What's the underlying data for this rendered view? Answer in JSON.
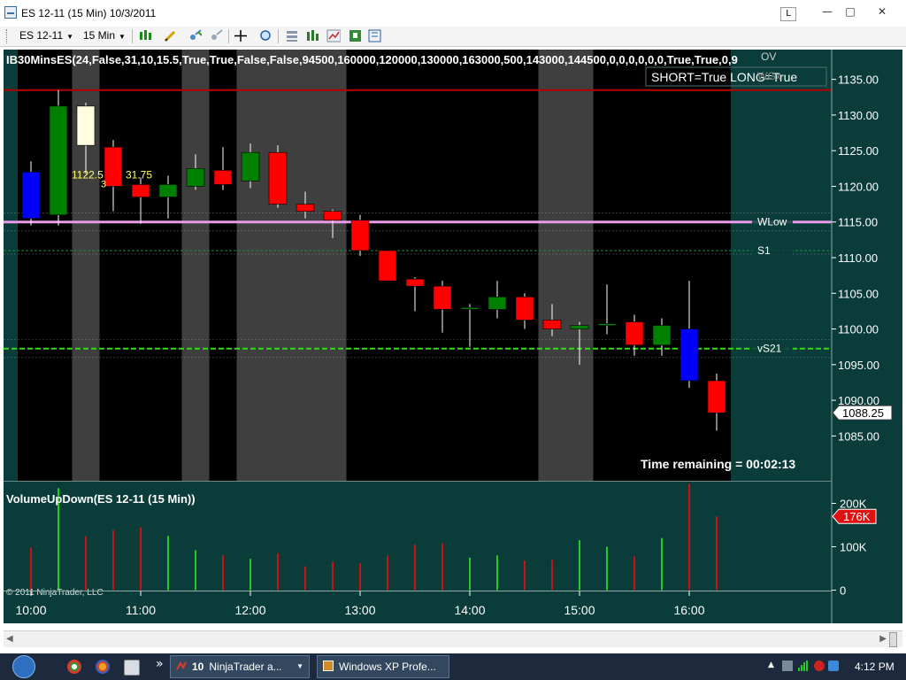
{
  "window": {
    "title": "ES 12-11 (15 Min)  10/3/2011",
    "l_button": "L",
    "min_glyph": "—",
    "max_glyph": "□",
    "close_glyph": "✕"
  },
  "toolbar": {
    "instrument": "ES 12-11",
    "interval": "15 Min",
    "dropdown_glyph": "▼",
    "icons": [
      "candlestick-style-icon",
      "pencil-draw-icon",
      "add-indicator-icon",
      "remove-indicator-icon",
      "crosshair-icon",
      "zoom-icon",
      "properties-icon",
      "bar-chart-icon",
      "line-chart-icon",
      "strategy-icon",
      "data-box-icon"
    ]
  },
  "colors": {
    "panel_bg": "#0a3d3a",
    "plot_bg": "#000000",
    "session_band": "#3f3f3f",
    "up_candle": "#008000",
    "down_candle": "#ff0000",
    "blue_candle": "#0000ff",
    "doji_candle": "#fffde0",
    "wick": "#ffffff",
    "axis_text": "#ffffff",
    "wlow_line": "#e79ae7",
    "top_red_line": "#b30000",
    "green_dash": "#33dd11",
    "vol_up": "#22cc22",
    "vol_down": "#cc1111",
    "label_yellow": "#ffff66"
  },
  "price_panel": {
    "indicator_text": "IB30MinsES(24,False,31,10,15.5,True,True,False,False,94500,160000,120000,130000,163000,500,143000,144500,0,0,0,0,0,0,True,True,0,9",
    "short_long_text": "SHORT=True LONG=True",
    "ov_label": "OV",
    "wh_label": "WGx",
    "wlow_label": "WLow",
    "s1_label": "S1",
    "s2_label": "vS21",
    "hl_label_1": "1122.5",
    "hl_label_2": "31.75",
    "hl_label_3": "3",
    "time_remaining": "Time remaining = 00:02:13",
    "last_price_label": "1088.25"
  },
  "volume_panel": {
    "title": "VolumeUpDown(ES 12-11 (15 Min))",
    "copyright": "© 2011 NinjaTrader, LLC",
    "last_volume_label": "176K"
  },
  "x_axis_labels": [
    "10:00",
    "11:00",
    "12:00",
    "13:00",
    "14:00",
    "15:00",
    "16:00"
  ],
  "taskbar": {
    "ninja_count": "10",
    "ninja_label": "NinjaTrader a...",
    "xp_label": "Windows XP Profe...",
    "more_glyph": "»",
    "clock": "4:12 PM"
  },
  "chart_data": [
    {
      "type": "candlestick",
      "title": "ES 12-11 (15 Min)",
      "xlabel": "",
      "ylabel": "",
      "ylim": [
        1082.5,
        1137.5
      ],
      "y_ticks": [
        1085,
        1090,
        1095,
        1100,
        1105,
        1110,
        1115,
        1120,
        1125,
        1130,
        1135
      ],
      "x_ticks": [
        "10:00",
        "11:00",
        "12:00",
        "13:00",
        "14:00",
        "15:00",
        "16:00"
      ],
      "grid": false,
      "reference_lines": [
        {
          "label": "",
          "value": 1133.5,
          "color": "#b30000"
        },
        {
          "label": "WLow",
          "value": 1115.0,
          "color": "#e79ae7"
        },
        {
          "label": "S1",
          "value": 1111.0,
          "color": "#208a3c"
        },
        {
          "label": "vS21",
          "value": 1097.25,
          "color": "#33dd11"
        }
      ],
      "candles": [
        {
          "time": "10:00",
          "open": 1115.5,
          "high": 1123.5,
          "low": 1114.5,
          "close": 1122.0,
          "color": "blue"
        },
        {
          "time": "10:15",
          "open": 1116.0,
          "high": 1133.5,
          "low": 1114.5,
          "close": 1131.25,
          "color": "green"
        },
        {
          "time": "10:30",
          "open": 1125.75,
          "high": 1131.75,
          "low": 1121.75,
          "close": 1131.25,
          "color": "cream"
        },
        {
          "time": "10:45",
          "open": 1125.5,
          "high": 1126.5,
          "low": 1116.5,
          "close": 1120.0,
          "color": "red"
        },
        {
          "time": "11:00",
          "open": 1120.25,
          "high": 1121.25,
          "low": 1114.75,
          "close": 1118.5,
          "color": "red"
        },
        {
          "time": "11:15",
          "open": 1118.5,
          "high": 1121.5,
          "low": 1115.5,
          "close": 1120.25,
          "color": "green"
        },
        {
          "time": "11:30",
          "open": 1120.0,
          "high": 1124.5,
          "low": 1119.5,
          "close": 1122.5,
          "color": "green"
        },
        {
          "time": "11:45",
          "open": 1122.25,
          "high": 1125.5,
          "low": 1119.5,
          "close": 1120.25,
          "color": "red"
        },
        {
          "time": "12:00",
          "open": 1120.75,
          "high": 1126.0,
          "low": 1119.75,
          "close": 1124.75,
          "color": "green"
        },
        {
          "time": "12:15",
          "open": 1124.75,
          "high": 1125.75,
          "low": 1117.0,
          "close": 1117.5,
          "color": "red"
        },
        {
          "time": "12:30",
          "open": 1117.5,
          "high": 1119.25,
          "low": 1115.5,
          "close": 1116.5,
          "color": "red"
        },
        {
          "time": "12:45",
          "open": 1116.5,
          "high": 1116.75,
          "low": 1112.75,
          "close": 1115.25,
          "color": "red"
        },
        {
          "time": "13:00",
          "open": 1115.25,
          "high": 1116.0,
          "low": 1110.25,
          "close": 1111.0,
          "color": "red"
        },
        {
          "time": "13:15",
          "open": 1111.0,
          "high": 1111.0,
          "low": 1106.75,
          "close": 1106.75,
          "color": "red"
        },
        {
          "time": "13:30",
          "open": 1107.0,
          "high": 1107.25,
          "low": 1102.5,
          "close": 1106.0,
          "color": "red"
        },
        {
          "time": "13:45",
          "open": 1106.0,
          "high": 1106.75,
          "low": 1099.5,
          "close": 1102.75,
          "color": "red"
        },
        {
          "time": "14:00",
          "open": 1102.75,
          "high": 1103.5,
          "low": 1097.5,
          "close": 1103.0,
          "color": "green"
        },
        {
          "time": "14:15",
          "open": 1102.75,
          "high": 1106.75,
          "low": 1101.5,
          "close": 1104.5,
          "color": "green"
        },
        {
          "time": "14:30",
          "open": 1104.5,
          "high": 1105.0,
          "low": 1100.0,
          "close": 1101.25,
          "color": "red"
        },
        {
          "time": "14:45",
          "open": 1101.25,
          "high": 1103.5,
          "low": 1099.0,
          "close": 1100.0,
          "color": "red"
        },
        {
          "time": "15:00",
          "open": 1100.0,
          "high": 1101.0,
          "low": 1095.0,
          "close": 1100.5,
          "color": "green"
        },
        {
          "time": "15:15",
          "open": 1100.5,
          "high": 1106.25,
          "low": 1099.25,
          "close": 1100.75,
          "color": "green"
        },
        {
          "time": "15:30",
          "open": 1101.0,
          "high": 1102.0,
          "low": 1096.25,
          "close": 1097.75,
          "color": "red"
        },
        {
          "time": "15:45",
          "open": 1097.75,
          "high": 1101.5,
          "low": 1096.25,
          "close": 1100.5,
          "color": "green"
        },
        {
          "time": "16:00",
          "open": 1100.0,
          "high": 1106.75,
          "low": 1091.75,
          "close": 1092.75,
          "color": "blue"
        },
        {
          "time": "16:15",
          "open": 1092.75,
          "high": 1093.75,
          "low": 1085.75,
          "close": 1088.25,
          "color": "red"
        }
      ],
      "session_bands": [
        {
          "start": "10:30",
          "end": "10:30"
        },
        {
          "start": "11:30",
          "end": "11:30"
        },
        {
          "start": "12:00",
          "end": "12:45"
        },
        {
          "start": "14:45",
          "end": "15:00"
        }
      ]
    },
    {
      "type": "bar",
      "title": "VolumeUpDown(ES 12-11 (15 Min))",
      "ylim": [
        0,
        250000
      ],
      "y_ticks": [
        0,
        100000,
        200000
      ],
      "y_tick_labels": [
        "0",
        "100K",
        "200K"
      ],
      "categories": [
        "10:00",
        "10:15",
        "10:30",
        "10:45",
        "11:00",
        "11:15",
        "11:30",
        "11:45",
        "12:00",
        "12:15",
        "12:30",
        "12:45",
        "13:00",
        "13:15",
        "13:30",
        "13:45",
        "14:00",
        "14:15",
        "14:30",
        "14:45",
        "15:00",
        "15:15",
        "15:30",
        "15:45",
        "16:00",
        "16:15"
      ],
      "values": [
        98000,
        235000,
        124000,
        138000,
        145000,
        125000,
        92000,
        80000,
        72000,
        85000,
        55000,
        65000,
        62000,
        80000,
        105000,
        108000,
        75000,
        80000,
        68000,
        70000,
        115000,
        100000,
        78000,
        120000,
        245000,
        170000
      ],
      "directions": [
        "down",
        "up",
        "down",
        "down",
        "down",
        "up",
        "up",
        "down",
        "up",
        "down",
        "down",
        "down",
        "down",
        "down",
        "down",
        "down",
        "up",
        "up",
        "down",
        "down",
        "up",
        "up",
        "down",
        "up",
        "down",
        "down"
      ]
    }
  ]
}
